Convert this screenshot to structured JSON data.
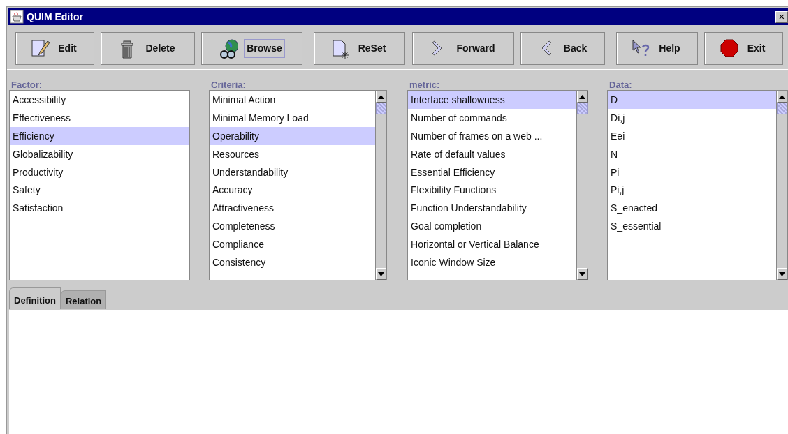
{
  "window": {
    "title": "QUIM Editor",
    "close": "×"
  },
  "toolbar": [
    {
      "label": "Edit",
      "focused": false
    },
    {
      "label": "Delete",
      "focused": false
    },
    {
      "label": "Browse",
      "focused": true
    },
    {
      "label": "ReSet",
      "focused": false
    },
    {
      "label": "Forward",
      "focused": false
    },
    {
      "label": "Back",
      "focused": false
    },
    {
      "label": "Help",
      "focused": false
    },
    {
      "label": "Exit",
      "focused": false
    }
  ],
  "lists": [
    {
      "header": "Factor:",
      "scrollbar": false,
      "items": [
        {
          "text": "Accessibility",
          "selected": false
        },
        {
          "text": "Effectiveness",
          "selected": false
        },
        {
          "text": "Efficiency",
          "selected": true
        },
        {
          "text": "Globalizability",
          "selected": false
        },
        {
          "text": "Productivity",
          "selected": false
        },
        {
          "text": "Safety",
          "selected": false
        },
        {
          "text": "Satisfaction",
          "selected": false
        }
      ]
    },
    {
      "header": "Criteria:",
      "scrollbar": true,
      "items": [
        {
          "text": "Minimal Action",
          "selected": false
        },
        {
          "text": "Minimal Memory Load",
          "selected": false
        },
        {
          "text": "Operability",
          "selected": true
        },
        {
          "text": "Resources",
          "selected": false
        },
        {
          "text": "Understandability",
          "selected": false
        },
        {
          "text": "Accuracy",
          "selected": false
        },
        {
          "text": "Attractiveness",
          "selected": false
        },
        {
          "text": "Completeness",
          "selected": false
        },
        {
          "text": "Compliance",
          "selected": false
        },
        {
          "text": "Consistency",
          "selected": false
        }
      ]
    },
    {
      "header": "metric:",
      "scrollbar": true,
      "items": [
        {
          "text": "Interface shallowness",
          "selected": true
        },
        {
          "text": "Number of commands",
          "selected": false
        },
        {
          "text": "Number of frames on a web ...",
          "selected": false
        },
        {
          "text": "Rate of default values",
          "selected": false
        },
        {
          "text": "Essential Efficiency",
          "selected": false
        },
        {
          "text": "Flexibility Functions",
          "selected": false
        },
        {
          "text": "Function Understandability",
          "selected": false
        },
        {
          "text": "Goal completion",
          "selected": false
        },
        {
          "text": "Horizontal or Vertical Balance",
          "selected": false
        },
        {
          "text": "Iconic Window Size",
          "selected": false
        }
      ]
    },
    {
      "header": "Data:",
      "scrollbar": true,
      "items": [
        {
          "text": "D",
          "selected": true
        },
        {
          "text": "Di,j",
          "selected": false
        },
        {
          "text": "Eei",
          "selected": false
        },
        {
          "text": "N",
          "selected": false
        },
        {
          "text": "Pi",
          "selected": false
        },
        {
          "text": "Pi,j",
          "selected": false
        },
        {
          "text": "S_enacted",
          "selected": false
        },
        {
          "text": "S_essential",
          "selected": false
        }
      ]
    }
  ],
  "tabs": [
    {
      "label": "Definition",
      "selected": true
    },
    {
      "label": "Relation",
      "selected": false
    }
  ]
}
